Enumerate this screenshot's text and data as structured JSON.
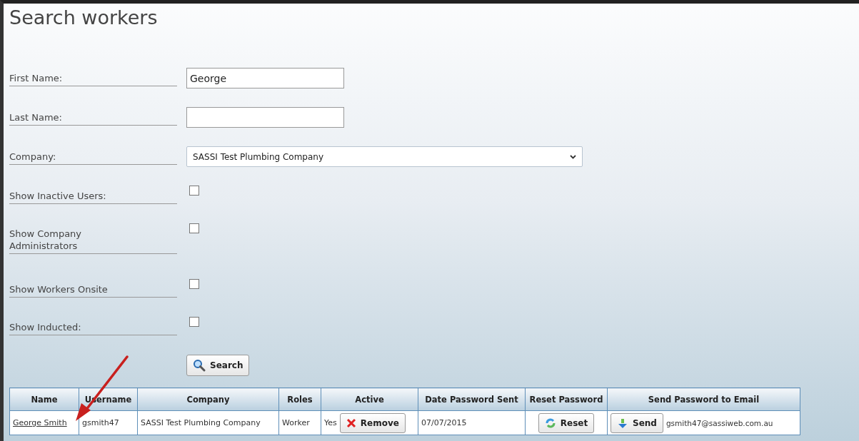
{
  "page": {
    "title": "Search workers"
  },
  "fields": [
    {
      "kind": "text",
      "label": "First Name:",
      "value": "George"
    },
    {
      "kind": "text",
      "label": "Last Name:"
    },
    {
      "kind": "select",
      "label": "Company:",
      "value": "SASSI Test Plumbing Company"
    },
    {
      "kind": "checkbox",
      "label": "Show Inactive Users:",
      "checked": false
    },
    {
      "kind": "checkbox",
      "label": "Show Company Administrators",
      "checked": false
    },
    {
      "kind": "checkbox",
      "label": "Show Workers Onsite",
      "checked": false
    },
    {
      "kind": "checkbox",
      "label": "Show Inducted:",
      "checked": false
    }
  ],
  "search_button": {
    "label": "Search"
  },
  "table": {
    "columns": [
      "Name",
      "Username",
      "Company",
      "Roles",
      "Active",
      "Date Password Sent",
      "Reset Password",
      "Send Password to Email"
    ],
    "rows": [
      {
        "name": "George Smith",
        "username": "gsmith47",
        "company": "SASSI Test Plumbing Company",
        "roles": "Worker",
        "active": "Yes",
        "remove_button": "Remove",
        "date_password_sent": "07/07/2015",
        "reset_button": "Reset",
        "send_button": "Send",
        "email": "gsmith47@sassiweb.com.au"
      }
    ]
  }
}
